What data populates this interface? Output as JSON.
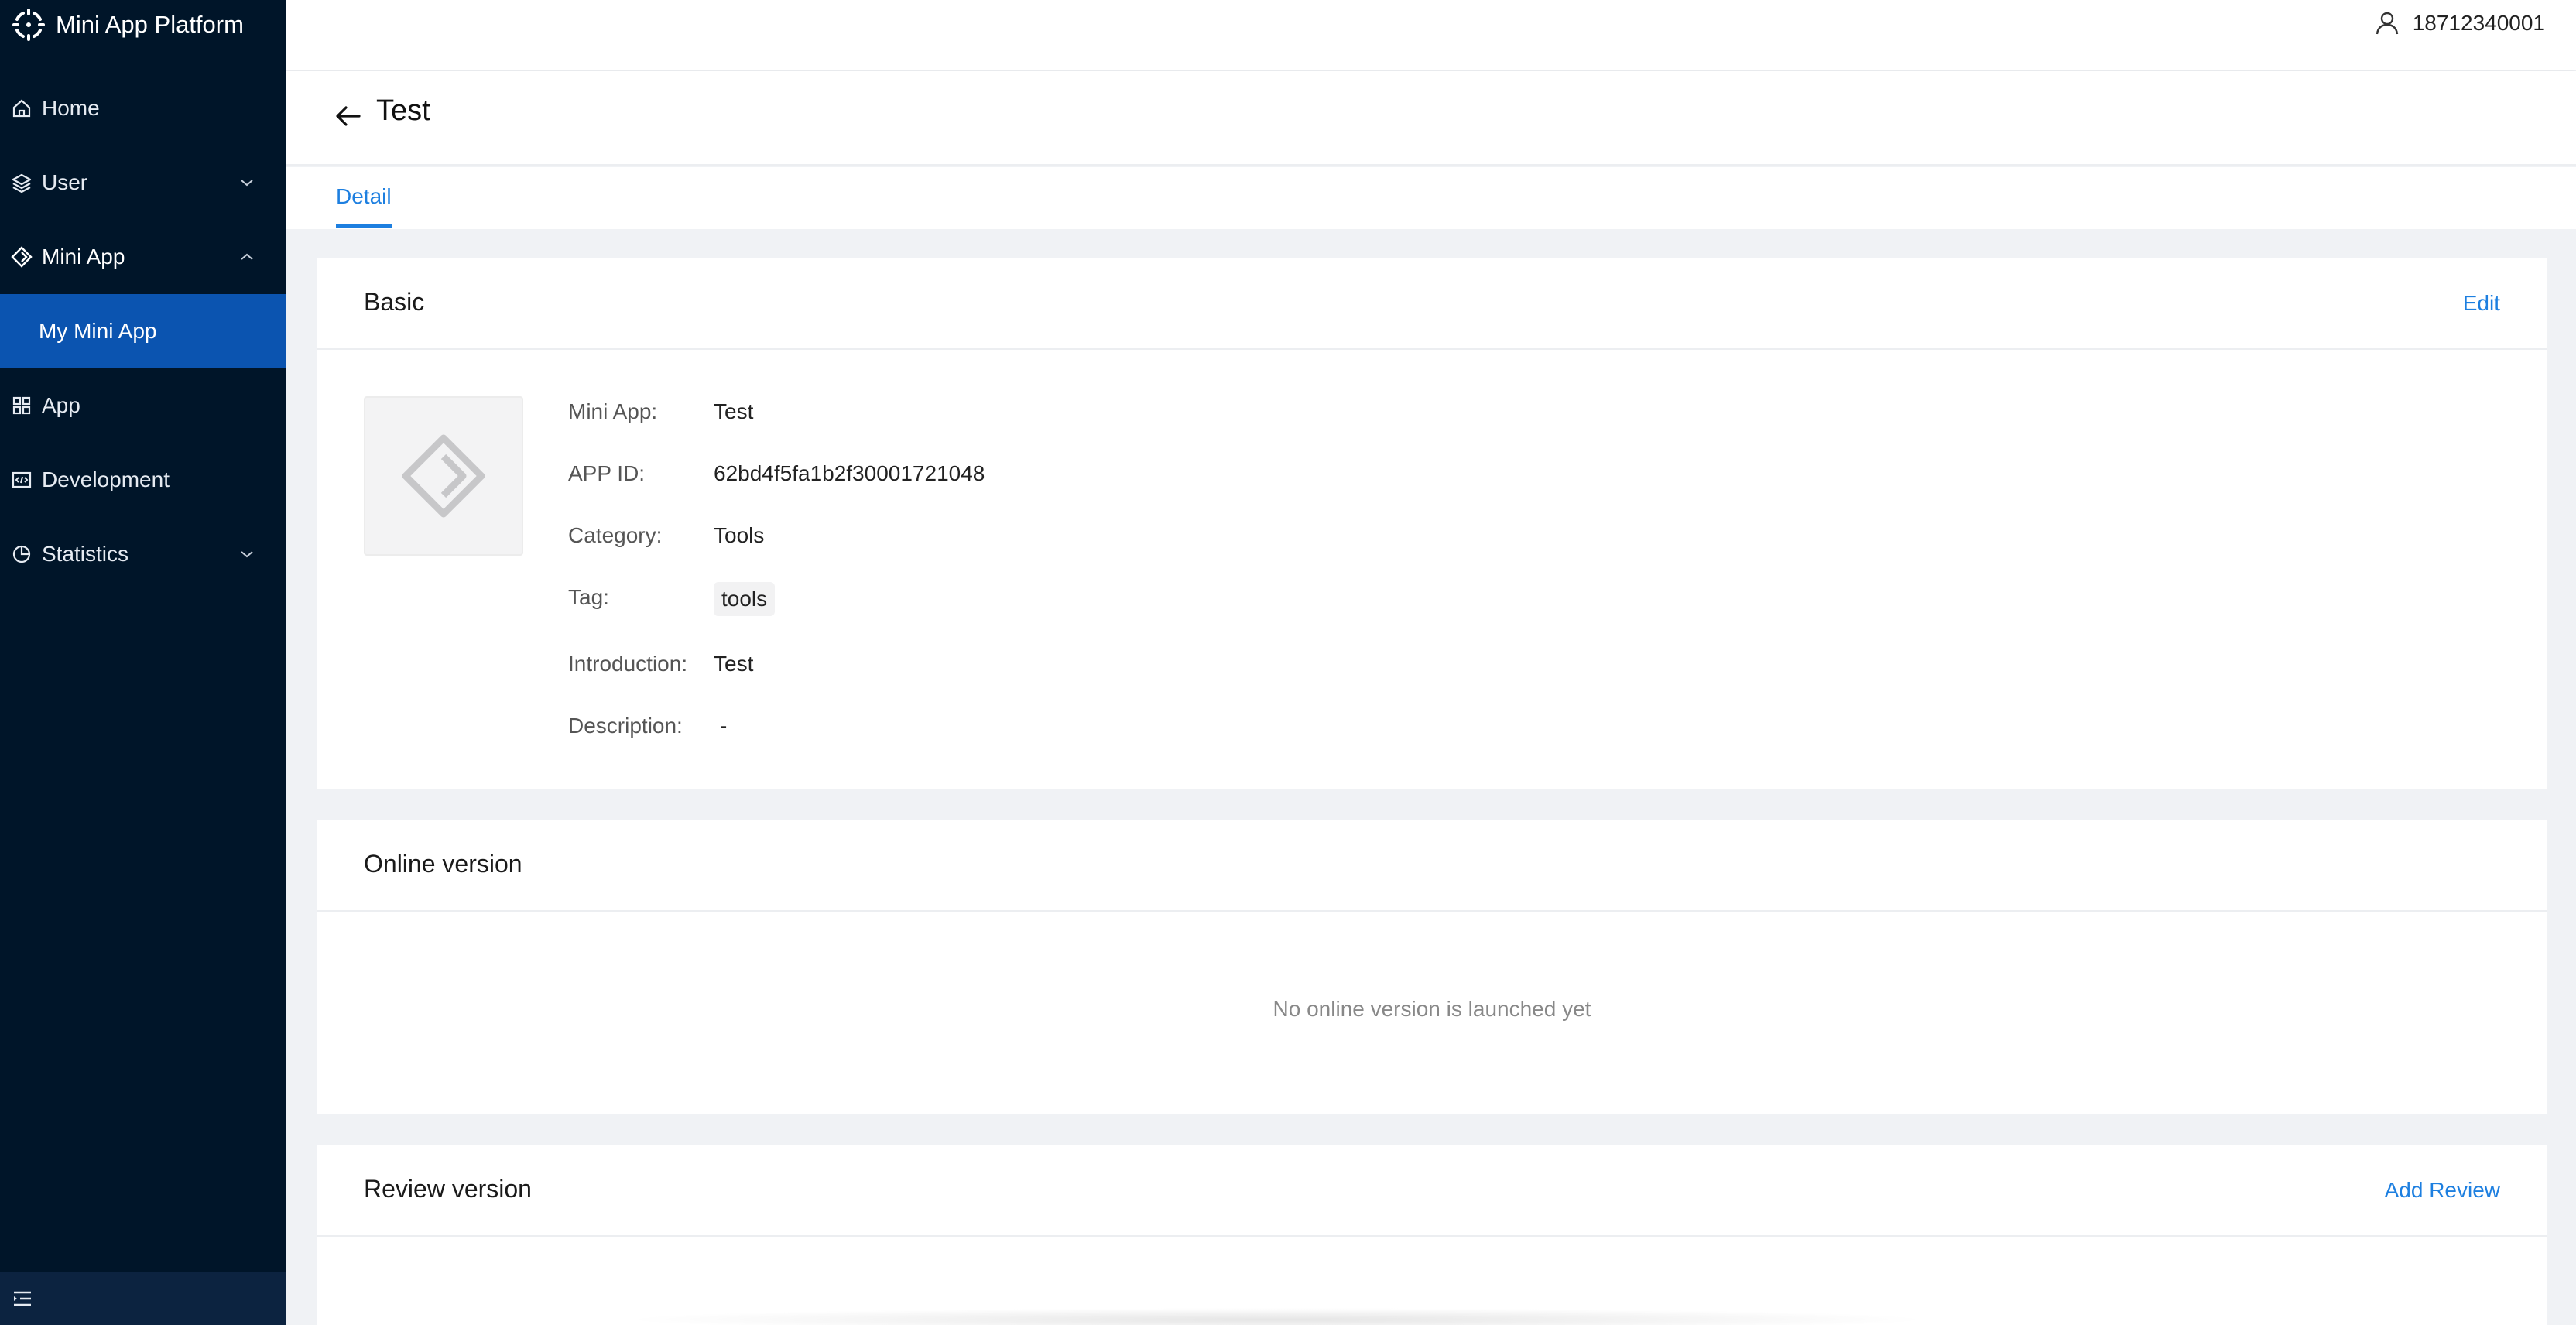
{
  "app": {
    "brand_name": "Mini App Platform",
    "accent_color": "#1d7fe0",
    "sidebar_color": "#001529",
    "selected_color": "#0b54b0"
  },
  "sidebar": {
    "items": [
      {
        "label": "Home",
        "icon": "home-icon"
      },
      {
        "label": "User",
        "icon": "layers-icon",
        "expandable": true,
        "expanded": false
      },
      {
        "label": "Mini App",
        "icon": "diamond-icon",
        "expandable": true,
        "expanded": true
      },
      {
        "label": "My Mini App",
        "sub": true,
        "selected": true
      },
      {
        "label": "App",
        "icon": "grid-icon"
      },
      {
        "label": "Development",
        "icon": "code-icon"
      },
      {
        "label": "Statistics",
        "icon": "pie-chart-icon",
        "expandable": true,
        "expanded": false
      }
    ],
    "footer_icon": "menu-fold-icon"
  },
  "header": {
    "user_phone": "18712340001",
    "user_icon": "user-icon"
  },
  "page": {
    "title": "Test",
    "back_icon": "arrow-left-icon",
    "tabs": [
      {
        "label": "Detail",
        "active": true
      }
    ]
  },
  "basic": {
    "title": "Basic",
    "action": "Edit",
    "icon_placeholder": "mini-app-placeholder-icon",
    "fields": [
      {
        "label": "Mini App:",
        "value": "Test"
      },
      {
        "label": "APP ID:",
        "value": "62bd4f5fa1b2f30001721048"
      },
      {
        "label": "Category:",
        "value": "Tools"
      },
      {
        "label": "Tag:",
        "value": "tools"
      },
      {
        "label": "Introduction:",
        "value": "Test"
      },
      {
        "label": "Description:",
        "value": "-"
      }
    ]
  },
  "online": {
    "title": "Online version",
    "empty": "No online version is launched yet"
  },
  "review": {
    "title": "Review version",
    "action": "Add Review"
  }
}
